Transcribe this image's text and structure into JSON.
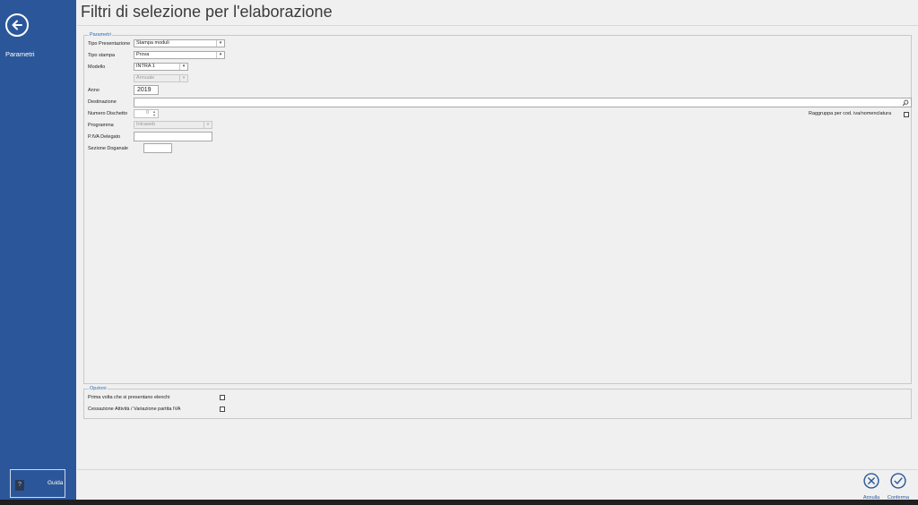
{
  "window": {
    "title": "Filtri di selezione per l'elaborazione"
  },
  "sidebar": {
    "back_icon": "arrow-left-circle-icon",
    "items": [
      {
        "label": "Parametri"
      }
    ],
    "help": {
      "label": "Guida",
      "icon_glyph": "?"
    }
  },
  "parametri": {
    "legend": "Parametri",
    "tipo_presentazione": {
      "label": "Tipo Presentazione",
      "value": "Stampa moduli"
    },
    "tipo_stampa": {
      "label": "Tipo stampa",
      "value": "Prova"
    },
    "modello": {
      "label": "Modello",
      "value": "INTRA 1"
    },
    "periodicita": {
      "value": "Annuale"
    },
    "anno": {
      "label": "Anno",
      "value": "2019"
    },
    "destinazione": {
      "label": "Destinazione",
      "value": ""
    },
    "numero_dischetto": {
      "label": "Numero Dischetto",
      "value": "0"
    },
    "programma": {
      "label": "Programma",
      "value": "Intraweb"
    },
    "piva_delegato": {
      "label": "P.IVA Delegato",
      "value": ""
    },
    "sezione_doganale": {
      "label": "Sezione Doganale",
      "value": ""
    },
    "raggruppa": {
      "label": "Raggruppa per cod. iva/nomenclatura",
      "checked": false
    }
  },
  "opzioni": {
    "legend": "Opzioni",
    "prima_volta": {
      "label": "Prima volta che si presentano elenchi",
      "checked": false
    },
    "cessazione": {
      "label": "Cessazione Attività / Variazione partita IVA",
      "checked": false
    }
  },
  "actions": {
    "annulla": {
      "label": "Annulla",
      "icon": "cancel-circle-icon"
    },
    "conferma": {
      "label": "Conferma",
      "icon": "check-circle-icon"
    }
  },
  "colors": {
    "sidebar": "#2b579a",
    "accent": "#2b579a",
    "legend": "#2b6cb5",
    "background": "#f0f0f0"
  }
}
